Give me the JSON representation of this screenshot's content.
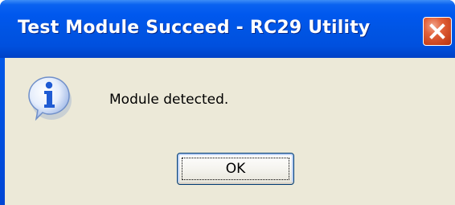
{
  "window": {
    "title": "Test Module Succeed - RC29 Utility",
    "close_icon": "close-icon"
  },
  "dialog": {
    "icon": "info-icon",
    "message": "Module detected.",
    "ok_label": "OK"
  },
  "colors": {
    "titlebar": "#0054e3",
    "close_button": "#e2613a",
    "client_background": "#ece9d8",
    "info_icon": "#1f5bd3"
  }
}
